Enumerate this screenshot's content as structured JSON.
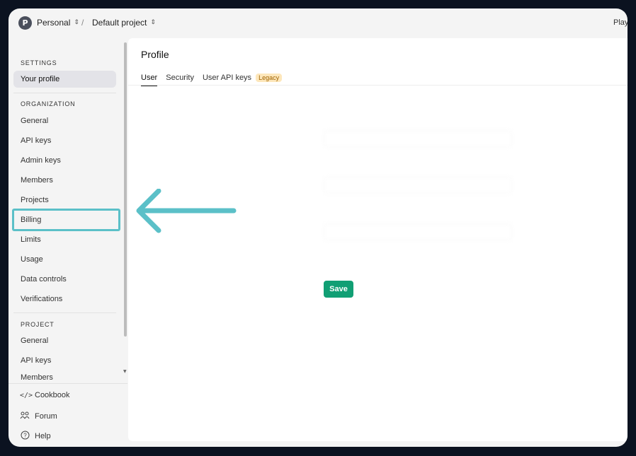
{
  "topbar": {
    "avatar_letter": "P",
    "org": "Personal",
    "separator": "/",
    "project": "Default project",
    "right_label": "Play"
  },
  "sidebar": {
    "settings_heading": "SETTINGS",
    "your_profile": "Your profile",
    "organization_heading": "ORGANIZATION",
    "org_items": [
      "General",
      "API keys",
      "Admin keys",
      "Members",
      "Projects",
      "Billing",
      "Limits",
      "Usage",
      "Data controls",
      "Verifications"
    ],
    "project_heading": "PROJECT",
    "project_items": [
      "General",
      "API keys",
      "Members"
    ],
    "footer": [
      {
        "label": "Cookbook",
        "icon": "code-icon"
      },
      {
        "label": "Forum",
        "icon": "people-icon"
      },
      {
        "label": "Help",
        "icon": "help-icon"
      }
    ]
  },
  "main": {
    "title": "Profile",
    "tabs": [
      "User",
      "Security",
      "User API keys"
    ],
    "legacy_badge": "Legacy",
    "save_label": "Save"
  },
  "colors": {
    "accent_green": "#119f74",
    "highlight": "#5bc0c8",
    "legacy_bg": "#fde7bb"
  }
}
